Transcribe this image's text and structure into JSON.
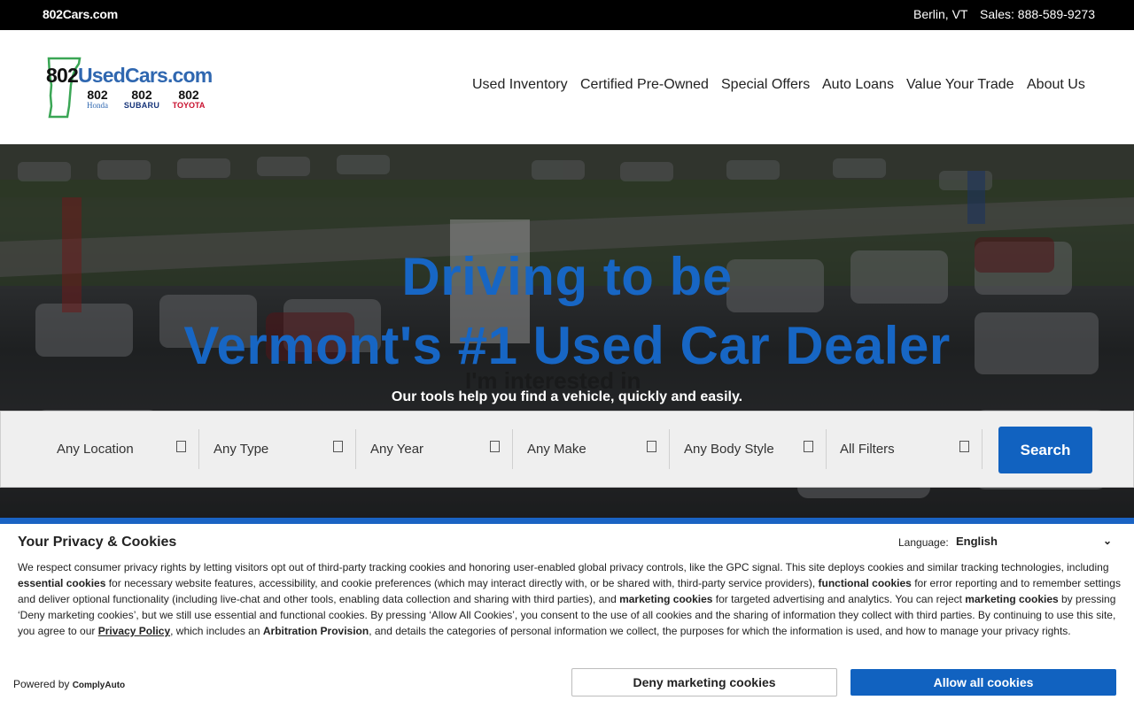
{
  "topbar": {
    "site": "802Cars.com",
    "location": "Berlin, VT",
    "sales": "Sales: 888-589-9273"
  },
  "logo": {
    "number": "802",
    "name": "UsedCars.com",
    "brands": [
      {
        "num": "802",
        "name": "Honda"
      },
      {
        "num": "802",
        "name": "SUBARU"
      },
      {
        "num": "802",
        "name": "TOYOTA"
      }
    ]
  },
  "nav": [
    "Used Inventory",
    "Certified Pre-Owned",
    "Special Offers",
    "Auto Loans",
    "Value Your Trade",
    "About Us"
  ],
  "hero": {
    "line1": "Driving to be",
    "line2": "Vermont's #1 Used Car Dealer",
    "interested": "I'm interested in",
    "subtitle": "Our tools help you find a vehicle, quickly and easily."
  },
  "search": {
    "filters": [
      "Any Location",
      "Any Type",
      "Any Year",
      "Any Make",
      "Any Body Style",
      "All Filters"
    ],
    "button": "Search"
  },
  "privacy": {
    "title": "Your Privacy & Cookies",
    "language_label": "Language:",
    "language_value": "English",
    "p1": "We respect consumer privacy rights by letting visitors opt out of third-party tracking cookies and honoring user-enabled global privacy controls, like the GPC signal. This site deploys cookies and similar tracking technologies, including ",
    "essential": "essential cookies",
    "p2": " for necessary website features, accessibility, and cookie preferences (which may interact directly with, or be shared with, third-party service providers), ",
    "functional": "functional cookies",
    "p3": " for error reporting and to remember settings and deliver optional functionality (including live-chat and other tools, enabling data collection and sharing with third parties), and ",
    "marketing": "marketing cookies",
    "p4": " for targeted advertising and analytics. You can reject ",
    "marketing2": "marketing cookies",
    "p5": " by pressing ‘Deny marketing cookies’, but we still use essential and functional cookies. By pressing ‘Allow All Cookies’, you consent to the use of all cookies and the sharing of information they collect with third parties. By continuing to use this site, you agree to our ",
    "policy_link": "Privacy Policy",
    "p6": ", which includes an ",
    "arbitration": "Arbitration Provision",
    "p7": ", and details the categories of personal information we collect, the purposes for which the information is used, and how to manage your privacy rights.",
    "powered_by": "Powered by ",
    "powered_brand": "ComplyAuto",
    "deny_button": "Deny marketing cookies",
    "allow_button": "Allow all cookies"
  },
  "colors": {
    "accent": "#1162c0",
    "headline": "#1766c4",
    "logo_blue": "#2f67b0",
    "vermont_green": "#3aa655"
  }
}
